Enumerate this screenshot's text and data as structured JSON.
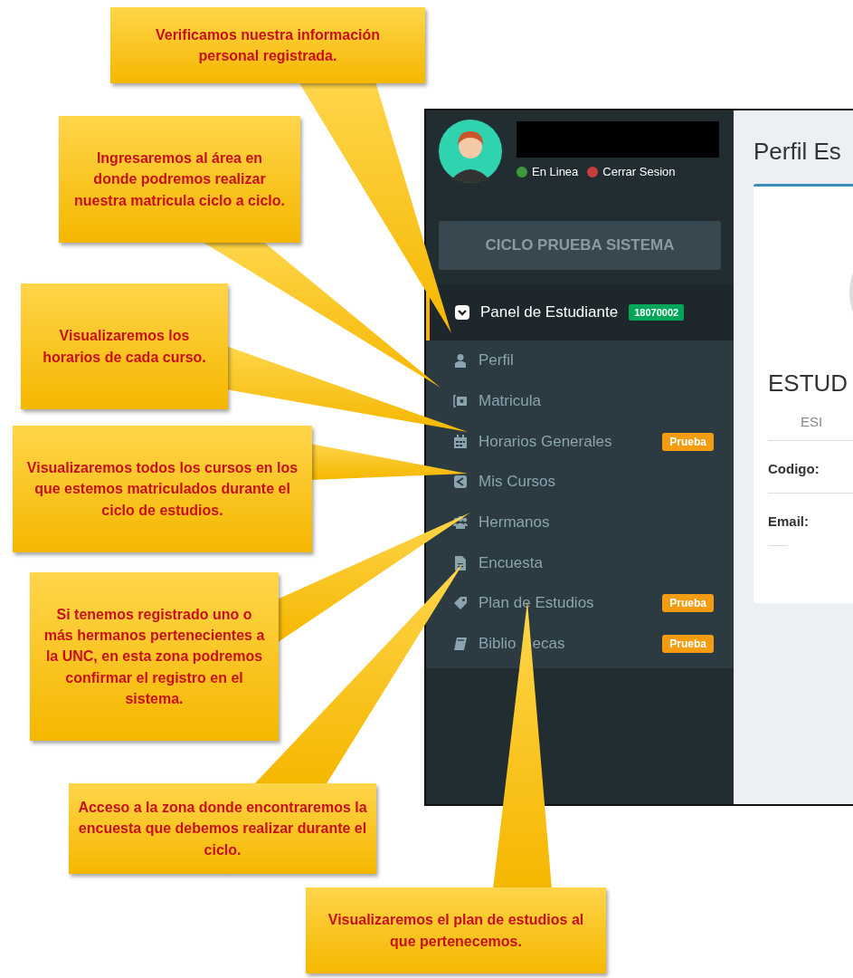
{
  "sidebar": {
    "status": [
      {
        "label": "En Linea",
        "color": "#3c9a3c"
      },
      {
        "label": "Cerrar Sesion",
        "color": "#c83c3c"
      }
    ],
    "cycle_button": "CICLO PRUEBA SISTEMA",
    "panel": {
      "label": "Panel de Estudiante",
      "badge": "18070002",
      "expanded": true
    },
    "items": [
      {
        "label": "Perfil"
      },
      {
        "label": "Matricula"
      },
      {
        "label": "Horarios Generales",
        "badge": "Prueba"
      },
      {
        "label": "Mis Cursos"
      },
      {
        "label": "Hermanos"
      },
      {
        "label": "Encuesta"
      },
      {
        "label": "Plan de Estudios",
        "badge": "Prueba"
      },
      {
        "label": "Biblio",
        "label_after_pointer": "ecas",
        "badge": "Prueba"
      }
    ]
  },
  "main": {
    "title": "Perfil Es",
    "name": "ESTUD",
    "subtitle": "ESI",
    "fields": [
      "Codigo:",
      "Email:"
    ]
  },
  "callouts": [
    "Verificamos nuestra información personal registrada.",
    "Ingresaremos al área en donde podremos realizar nuestra matricula ciclo a ciclo.",
    "Visualizaremos los horarios de cada curso.",
    "Visualizaremos todos los cursos en los que estemos matriculados durante el ciclo de estudios.",
    "Si tenemos registrado uno o más hermanos pertenecientes a la UNC, en esta zona podremos confirmar el registro en el sistema.",
    "Acceso a la zona donde encontraremos la encuesta que debemos realizar durante el ciclo.",
    "Visualizaremos el plan de estudios al que pertenecemos."
  ]
}
